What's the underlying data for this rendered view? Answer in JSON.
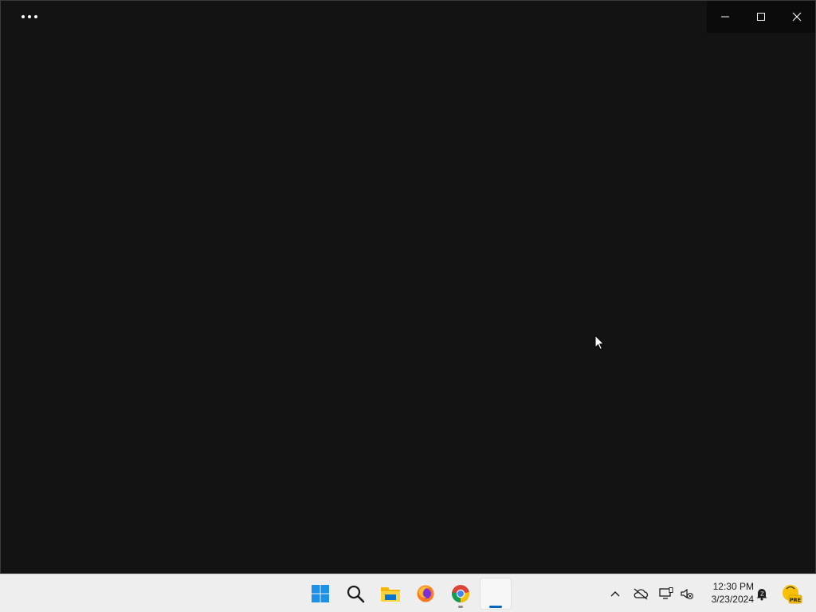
{
  "window": {
    "more_icon": "more-horizontal-icon",
    "controls": {
      "minimize_icon": "minimize-icon",
      "maximize_icon": "maximize-icon",
      "close_icon": "close-icon"
    }
  },
  "taskbar": {
    "apps": [
      {
        "name": "start",
        "icon": "windows-start-icon"
      },
      {
        "name": "search",
        "icon": "search-icon"
      },
      {
        "name": "file-explorer",
        "icon": "folder-icon"
      },
      {
        "name": "firefox",
        "icon": "firefox-icon"
      },
      {
        "name": "chrome",
        "icon": "chrome-icon"
      },
      {
        "name": "active-app",
        "icon": "blank-app-icon"
      }
    ],
    "tray": {
      "icons": [
        "chevron-up-icon",
        "cloud-off-icon",
        "display-icon",
        "speaker-muted-icon",
        "notification-icon",
        "pre-badge-icon"
      ],
      "time": "12:30 PM",
      "date": "3/23/2024",
      "badge_text": "PRE"
    },
    "colors": {
      "accent": "#0067c0",
      "windows_blue": "#1e90e6"
    }
  }
}
